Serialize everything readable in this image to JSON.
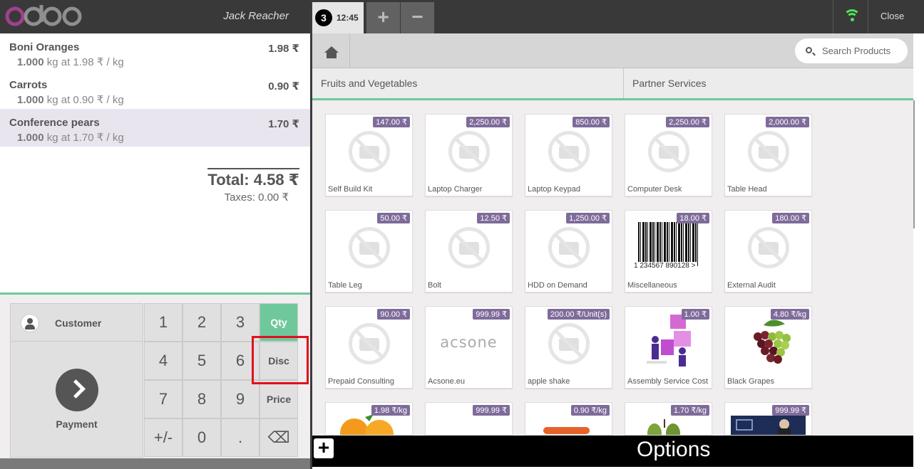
{
  "header": {
    "logo_text": "odoo",
    "cashier_name": "Jack Reacher"
  },
  "order_tab": {
    "number": "3",
    "time": "12:45"
  },
  "tab_buttons": {
    "add": "+",
    "remove": "−"
  },
  "topbar": {
    "close_label": "Close"
  },
  "orderlines": [
    {
      "name": "Boni Oranges",
      "price": "1.98 ₹",
      "qty": "1.000",
      "info": "kg at 1.98 ₹ / kg"
    },
    {
      "name": "Carrots",
      "price": "0.90 ₹",
      "qty": "1.000",
      "info": "kg at 0.90 ₹ / kg"
    },
    {
      "name": "Conference pears",
      "price": "1.70 ₹",
      "qty": "1.000",
      "info": "kg at 1.70 ₹ / kg"
    }
  ],
  "summary": {
    "total": "Total: 4.58 ₹",
    "taxes": "Taxes: 0.00 ₹"
  },
  "actions": {
    "customer_label": "Customer",
    "payment_label": "Payment"
  },
  "numpad": {
    "keys": [
      "1",
      "2",
      "3",
      "Qty",
      "4",
      "5",
      "6",
      "Disc",
      "7",
      "8",
      "9",
      "Price",
      "+/-",
      "0",
      ".",
      "⌫"
    ],
    "active_mode": "Qty"
  },
  "search": {
    "placeholder": "Search Products"
  },
  "categories": [
    "Fruits and Vegetables",
    "Partner Services"
  ],
  "products": [
    {
      "name": "Self Build Kit",
      "price": "147.00 ₹",
      "image": "placeholder"
    },
    {
      "name": "Laptop Charger",
      "price": "2,250.00 ₹",
      "image": "placeholder"
    },
    {
      "name": "Laptop Keypad",
      "price": "850.00 ₹",
      "image": "placeholder"
    },
    {
      "name": "Computer Desk",
      "price": "2,250.00 ₹",
      "image": "placeholder"
    },
    {
      "name": "Table Head",
      "price": "2,000.00 ₹",
      "image": "placeholder"
    },
    {
      "name": "Table Leg",
      "price": "50.00 ₹",
      "image": "placeholder"
    },
    {
      "name": "Bolt",
      "price": "12.50 ₹",
      "image": "placeholder"
    },
    {
      "name": "HDD on Demand",
      "price": "1,250.00 ₹",
      "image": "placeholder"
    },
    {
      "name": "Miscellaneous",
      "price": "18.00 ₹",
      "image": "barcode",
      "image_text": "1 234567 890128 >"
    },
    {
      "name": "External Audit",
      "price": "180.00 ₹",
      "image": "placeholder"
    },
    {
      "name": "Prepaid Consulting",
      "price": "90.00 ₹",
      "image": "placeholder"
    },
    {
      "name": "Acsone.eu",
      "price": "999.99 ₹",
      "image": "acsone-logo",
      "image_text": "acsone"
    },
    {
      "name": "apple shake",
      "price": "200.00 ₹/Unit(s)",
      "image": "placeholder"
    },
    {
      "name": "Assembly Service Cost",
      "price": "1.00 ₹",
      "image": "assembly-illustration"
    },
    {
      "name": "Black Grapes",
      "price": "4.80 ₹/kg",
      "image": "grapes-photo"
    },
    {
      "name": "",
      "price": "1.98 ₹/kg",
      "image": "oranges-photo"
    },
    {
      "name": "",
      "price": "999.99 ₹",
      "image": "blank"
    },
    {
      "name": "",
      "price": "0.90 ₹/kg",
      "image": "carrots-photo"
    },
    {
      "name": "",
      "price": "1.70 ₹/kg",
      "image": "pears-photo"
    },
    {
      "name": "",
      "price": "999.99 ₹",
      "image": "business-photo"
    }
  ],
  "bottombar": {
    "plus_label": "+",
    "options_label": "Options"
  },
  "colors": {
    "accent": "#6ec89b",
    "price_tag": "#7f6b9a",
    "dark_bar": "#393939",
    "highlight": "#e0111f",
    "logo_purple": "#a0418d"
  }
}
